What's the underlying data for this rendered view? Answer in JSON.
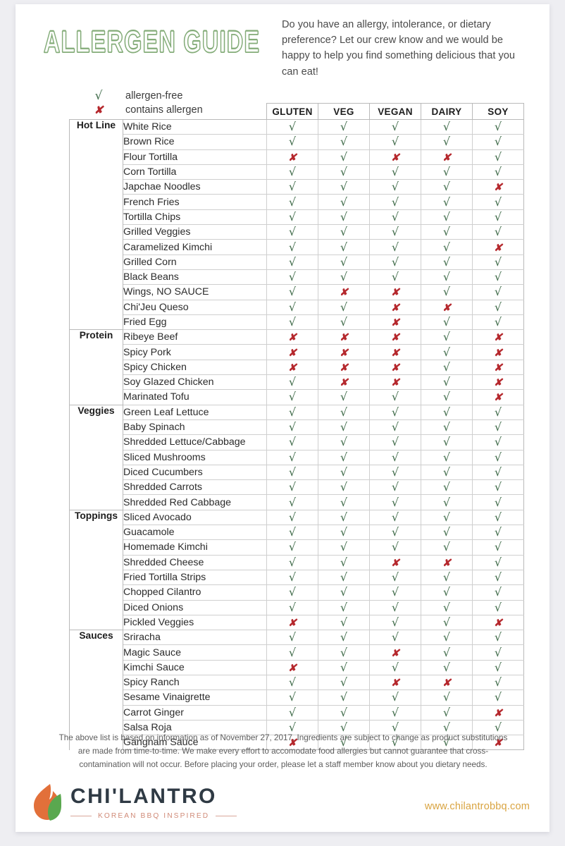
{
  "header": {
    "title": "ALLERGEN GUIDE",
    "intro": "Do you have an allergy, intolerance, or dietary preference?  Let our crew know and we would be happy to help you find something delicious that you can eat!"
  },
  "legend": {
    "yes_mark": "√",
    "yes_label": "allergen-free",
    "no_mark": "✘",
    "no_label": "contains allergen"
  },
  "marks": {
    "yes": "√",
    "no": "✘",
    "yes_color": "#3f6b49",
    "no_color": "#b5282d"
  },
  "table": {
    "columns": [
      "GLUTEN",
      "VEG",
      "VEGAN",
      "DAIRY",
      "SOY"
    ],
    "sections": [
      {
        "name": "Hot Line",
        "rows": [
          {
            "item": "White Rice",
            "flags": [
              "yes",
              "yes",
              "yes",
              "yes",
              "yes"
            ]
          },
          {
            "item": "Brown Rice",
            "flags": [
              "yes",
              "yes",
              "yes",
              "yes",
              "yes"
            ]
          },
          {
            "item": "Flour Tortilla",
            "flags": [
              "no",
              "yes",
              "no",
              "no",
              "yes"
            ]
          },
          {
            "item": "Corn Tortilla",
            "flags": [
              "yes",
              "yes",
              "yes",
              "yes",
              "yes"
            ]
          },
          {
            "item": "Japchae Noodles",
            "flags": [
              "yes",
              "yes",
              "yes",
              "yes",
              "no"
            ]
          },
          {
            "item": "French Fries",
            "flags": [
              "yes",
              "yes",
              "yes",
              "yes",
              "yes"
            ]
          },
          {
            "item": "Tortilla Chips",
            "flags": [
              "yes",
              "yes",
              "yes",
              "yes",
              "yes"
            ]
          },
          {
            "item": "Grilled Veggies",
            "flags": [
              "yes",
              "yes",
              "yes",
              "yes",
              "yes"
            ]
          },
          {
            "item": "Caramelized Kimchi",
            "flags": [
              "yes",
              "yes",
              "yes",
              "yes",
              "no"
            ]
          },
          {
            "item": "Grilled Corn",
            "flags": [
              "yes",
              "yes",
              "yes",
              "yes",
              "yes"
            ]
          },
          {
            "item": "Black Beans",
            "flags": [
              "yes",
              "yes",
              "yes",
              "yes",
              "yes"
            ]
          },
          {
            "item": "Wings, NO SAUCE",
            "flags": [
              "yes",
              "no",
              "no",
              "yes",
              "yes"
            ]
          },
          {
            "item": "Chi'Jeu Queso",
            "flags": [
              "yes",
              "yes",
              "no",
              "no",
              "yes"
            ]
          },
          {
            "item": "Fried Egg",
            "flags": [
              "yes",
              "yes",
              "no",
              "yes",
              "yes"
            ]
          }
        ]
      },
      {
        "name": "Protein",
        "rows": [
          {
            "item": "Ribeye Beef",
            "flags": [
              "no",
              "no",
              "no",
              "yes",
              "no"
            ]
          },
          {
            "item": "Spicy Pork",
            "flags": [
              "no",
              "no",
              "no",
              "yes",
              "no"
            ]
          },
          {
            "item": "Spicy Chicken",
            "flags": [
              "no",
              "no",
              "no",
              "yes",
              "no"
            ]
          },
          {
            "item": "Soy Glazed Chicken",
            "flags": [
              "yes",
              "no",
              "no",
              "yes",
              "no"
            ]
          },
          {
            "item": "Marinated Tofu",
            "flags": [
              "yes",
              "yes",
              "yes",
              "yes",
              "no"
            ]
          }
        ]
      },
      {
        "name": "Veggies",
        "rows": [
          {
            "item": "Green Leaf Lettuce",
            "flags": [
              "yes",
              "yes",
              "yes",
              "yes",
              "yes"
            ]
          },
          {
            "item": "Baby Spinach",
            "flags": [
              "yes",
              "yes",
              "yes",
              "yes",
              "yes"
            ]
          },
          {
            "item": "Shredded Lettuce/Cabbage",
            "flags": [
              "yes",
              "yes",
              "yes",
              "yes",
              "yes"
            ]
          },
          {
            "item": "Sliced Mushrooms",
            "flags": [
              "yes",
              "yes",
              "yes",
              "yes",
              "yes"
            ]
          },
          {
            "item": "Diced Cucumbers",
            "flags": [
              "yes",
              "yes",
              "yes",
              "yes",
              "yes"
            ]
          },
          {
            "item": "Shredded Carrots",
            "flags": [
              "yes",
              "yes",
              "yes",
              "yes",
              "yes"
            ]
          },
          {
            "item": "Shredded Red Cabbage",
            "flags": [
              "yes",
              "yes",
              "yes",
              "yes",
              "yes"
            ]
          }
        ]
      },
      {
        "name": "Toppings",
        "rows": [
          {
            "item": "Sliced Avocado",
            "flags": [
              "yes",
              "yes",
              "yes",
              "yes",
              "yes"
            ]
          },
          {
            "item": "Guacamole",
            "flags": [
              "yes",
              "yes",
              "yes",
              "yes",
              "yes"
            ]
          },
          {
            "item": "Homemade Kimchi",
            "flags": [
              "yes",
              "yes",
              "yes",
              "yes",
              "yes"
            ]
          },
          {
            "item": "Shredded Cheese",
            "flags": [
              "yes",
              "yes",
              "no",
              "no",
              "yes"
            ]
          },
          {
            "item": "Fried Tortilla Strips",
            "flags": [
              "yes",
              "yes",
              "yes",
              "yes",
              "yes"
            ]
          },
          {
            "item": "Chopped Cilantro",
            "flags": [
              "yes",
              "yes",
              "yes",
              "yes",
              "yes"
            ]
          },
          {
            "item": "Diced Onions",
            "flags": [
              "yes",
              "yes",
              "yes",
              "yes",
              "yes"
            ]
          },
          {
            "item": "Pickled Veggies",
            "flags": [
              "no",
              "yes",
              "yes",
              "yes",
              "no"
            ]
          }
        ]
      },
      {
        "name": "Sauces",
        "rows": [
          {
            "item": "Sriracha",
            "flags": [
              "yes",
              "yes",
              "yes",
              "yes",
              "yes"
            ]
          },
          {
            "item": "Magic Sauce",
            "flags": [
              "yes",
              "yes",
              "no",
              "yes",
              "yes"
            ]
          },
          {
            "item": "Kimchi Sauce",
            "flags": [
              "no",
              "yes",
              "yes",
              "yes",
              "yes"
            ]
          },
          {
            "item": "Spicy Ranch",
            "flags": [
              "yes",
              "yes",
              "no",
              "no",
              "yes"
            ]
          },
          {
            "item": "Sesame Vinaigrette",
            "flags": [
              "yes",
              "yes",
              "yes",
              "yes",
              "yes"
            ]
          },
          {
            "item": "Carrot Ginger",
            "flags": [
              "yes",
              "yes",
              "yes",
              "yes",
              "no"
            ]
          },
          {
            "item": "Salsa Roja",
            "flags": [
              "yes",
              "yes",
              "yes",
              "yes",
              "yes"
            ]
          },
          {
            "item": "Gangnam Sauce",
            "flags": [
              "no",
              "yes",
              "yes",
              "yes",
              "no"
            ]
          }
        ]
      }
    ]
  },
  "disclaimer": "The above list is based on information as of November 27, 2017.  Ingredients are subject to change as product substitutions are made from time-to-time.  We make every effort to accomodate food allergies but cannot guarantee that cross-contamination will not occur.  Before placing your order, please let a staff member know about you dietary needs.",
  "footer": {
    "logo_name": "CHI'LANTRO",
    "logo_tagline": "KOREAN BBQ INSPIRED",
    "website": "www.chilantrobbq.com"
  }
}
